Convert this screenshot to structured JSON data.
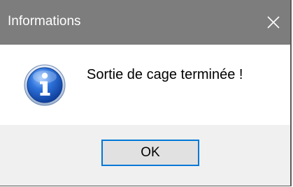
{
  "window": {
    "title": "Informations",
    "close_icon": "close-icon"
  },
  "dialog": {
    "icon": "info-icon",
    "message": "Sortie de cage terminée !"
  },
  "buttons": {
    "ok_label": "OK"
  },
  "colors": {
    "titlebar": "#7d7d7d",
    "focus_border": "#0078d7",
    "icon_blue": "#1f5fc4"
  }
}
